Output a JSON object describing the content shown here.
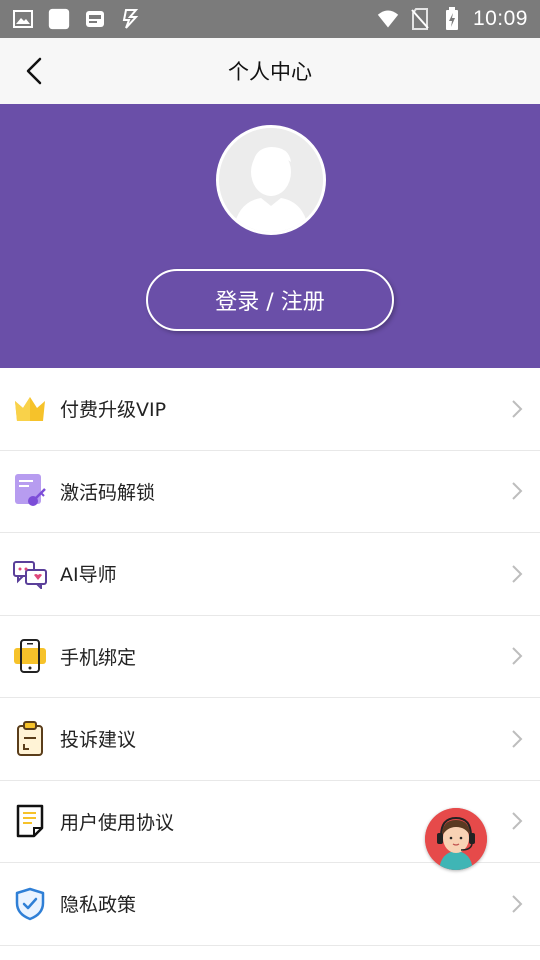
{
  "status_bar": {
    "time": "10:09",
    "icons": [
      "image-icon",
      "app-icon",
      "photo-icon",
      "sync-icon",
      "wifi-icon",
      "no-sim-icon",
      "battery-charging-icon"
    ]
  },
  "app_bar": {
    "title": "个人中心",
    "back_icon": "chevron-left-icon"
  },
  "header": {
    "background_color": "#6a4fa8",
    "avatar_icon": "default-avatar-icon",
    "login_button": "登录 / 注册"
  },
  "menu": {
    "items": [
      {
        "label": "付费升级VIP",
        "icon": "crown-icon"
      },
      {
        "label": "激活码解锁",
        "icon": "activation-code-icon"
      },
      {
        "label": "AI导师",
        "icon": "chat-bubbles-icon"
      },
      {
        "label": "手机绑定",
        "icon": "phone-icon"
      },
      {
        "label": "投诉建议",
        "icon": "clipboard-icon"
      },
      {
        "label": "用户使用协议",
        "icon": "document-icon"
      },
      {
        "label": "隐私政策",
        "icon": "shield-icon"
      }
    ],
    "chevron_icon": "chevron-right-icon"
  },
  "floating": {
    "icon": "customer-service-icon"
  }
}
